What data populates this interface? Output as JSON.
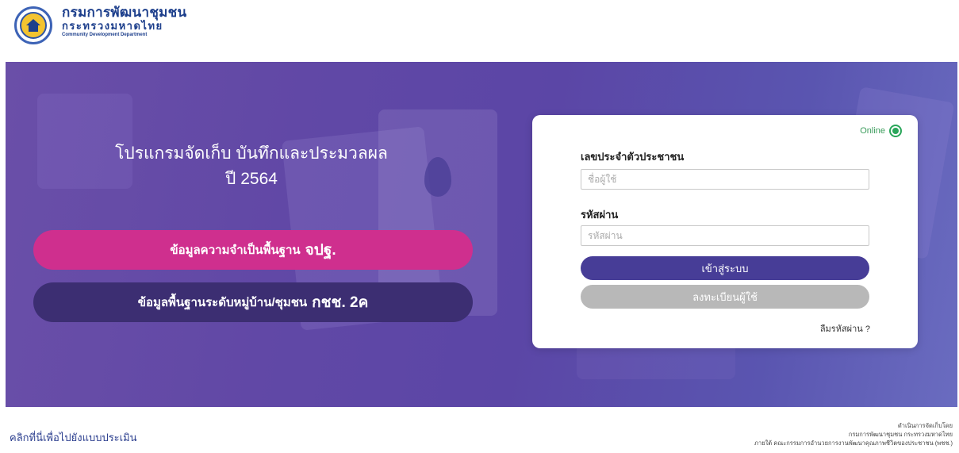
{
  "header": {
    "org_name_th": "กรมการพัฒนาชุมชน",
    "ministry_th": "กระทรวงมหาดไทย",
    "org_name_en": "Community Development Department"
  },
  "hero": {
    "title_line1": "โปรแกรมจัดเก็บ บันทึกและประมวลผล",
    "title_line2": "ปี 2564",
    "btn_jpt_prefix": "ข้อมูลความจำเป็นพื้นฐาน",
    "btn_jpt_strong": "จปฐ.",
    "btn_ksc_prefix": "ข้อมูลพื้นฐานระดับหมู่บ้าน/ชุมชน",
    "btn_ksc_strong": "กชช. 2ค"
  },
  "login": {
    "status": "Online",
    "id_label": "เลขประจำตัวประชาชน",
    "id_placeholder": "ชื่อผู้ใช้",
    "password_label": "รหัสผ่าน",
    "password_placeholder": "รหัสผ่าน",
    "login_button": "เข้าสู่ระบบ",
    "register_button": "ลงทะเบียนผู้ใช้",
    "forgot_link": "ลืมรหัสผ่าน ?"
  },
  "footer": {
    "evaluation_link": "คลิกที่นี่เพื่อไปยังแบบประเมิน",
    "right_line1": "ดำเนินการจัดเก็บโดย",
    "right_line2": "กรมการพัฒนาชุมชน กระทรวงมหาดไทย",
    "right_line3": "ภายใต้ คณะกรรมการอำนวยการงานพัฒนาคุณภาพชีวิตของประชาชน (พชช.)"
  },
  "colors": {
    "hero_bg": "#5f48a6",
    "jpt_button": "#cf2f8e",
    "ksc_button": "#3c2e72",
    "login_button": "#473d97",
    "register_button": "#b8b8b8",
    "online_status": "#2aa65a",
    "brand_blue": "#1d3f8c"
  }
}
